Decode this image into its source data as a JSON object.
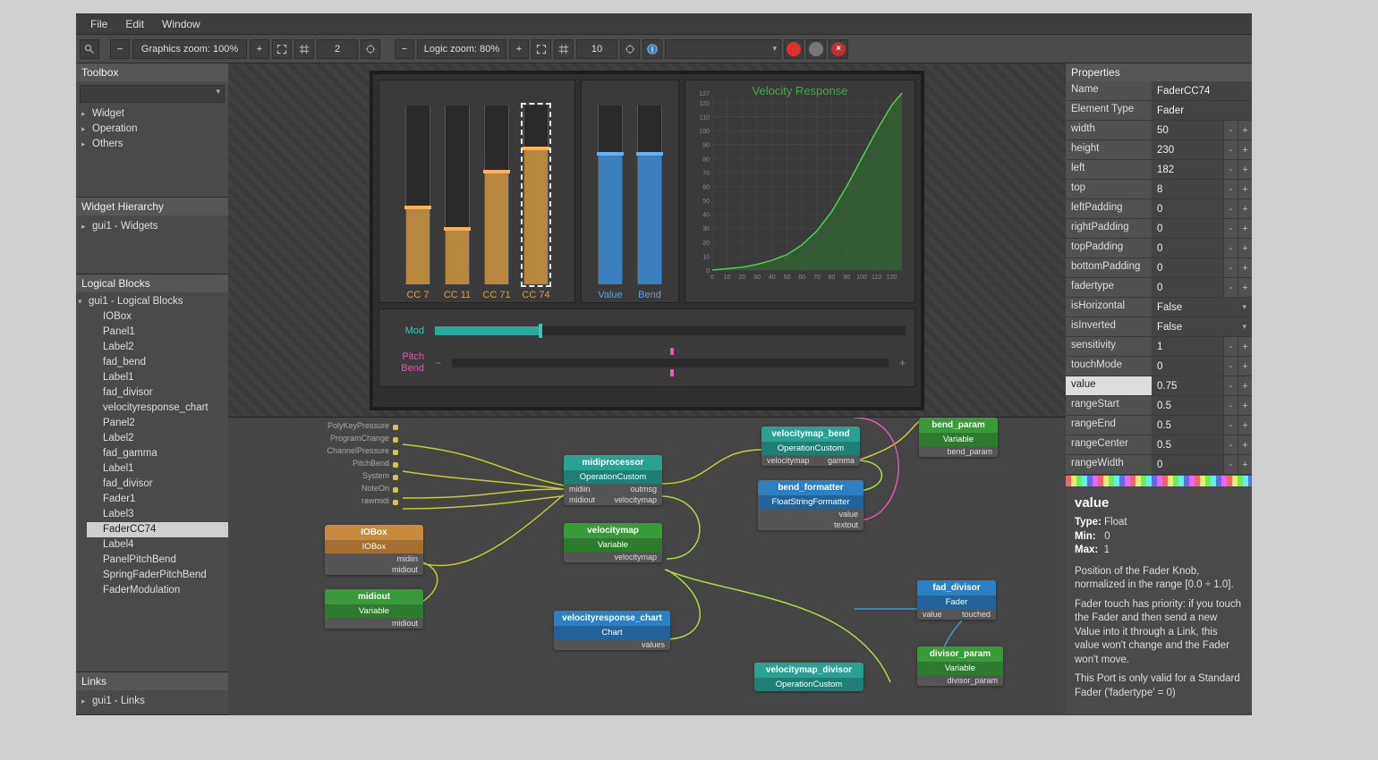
{
  "menu": {
    "file": "File",
    "edit": "Edit",
    "window": "Window"
  },
  "toolbar": {
    "gzoom": "Graphics zoom: 100%",
    "gstep": "2",
    "lzoom": "Logic zoom: 80%",
    "lstep": "10"
  },
  "toolbox": {
    "title": "Toolbox",
    "items": [
      "Widget",
      "Operation",
      "Others"
    ]
  },
  "hierarchy": {
    "title": "Widget Hierarchy",
    "root": "gui1 - Widgets"
  },
  "logical": {
    "title": "Logical Blocks",
    "root": "gui1 - Logical Blocks",
    "items": [
      "IOBox",
      "Panel1",
      "Label2",
      "fad_bend",
      "Label1",
      "fad_divisor",
      "velocityresponse_chart",
      "Panel2",
      "Label2",
      "fad_gamma",
      "Label1",
      "fad_divisor",
      "Fader1",
      "Label3",
      "FaderCC74",
      "Label4",
      "PanelPitchBend",
      "SpringFaderPitchBend",
      "FaderModulation"
    ],
    "selected": "FaderCC74"
  },
  "links": {
    "title": "Links",
    "root": "gui1 - Links"
  },
  "preview": {
    "faders_orange": [
      {
        "label": "CC 7",
        "fill": 0.42
      },
      {
        "label": "CC 11",
        "fill": 0.3
      },
      {
        "label": "CC 71",
        "fill": 0.62
      },
      {
        "label": "CC 74",
        "fill": 0.75,
        "selected": true
      }
    ],
    "faders_blue": [
      {
        "label": "Value",
        "fill": 0.72
      },
      {
        "label": "Bend",
        "fill": 0.72
      }
    ],
    "mod": {
      "label": "Mod",
      "value": 0.22
    },
    "pitch": {
      "label": "Pitch Bend",
      "value": 0.5
    }
  },
  "chart_data": {
    "type": "line",
    "title": "Velocity Response",
    "xlabel": "",
    "ylabel": "",
    "xlim": [
      0,
      127
    ],
    "ylim": [
      0,
      127
    ],
    "x": [
      0,
      10,
      20,
      30,
      40,
      50,
      60,
      70,
      80,
      90,
      100,
      110,
      120,
      127
    ],
    "values": [
      0,
      1,
      2,
      4,
      7,
      11,
      18,
      28,
      42,
      60,
      80,
      100,
      118,
      127
    ],
    "x_ticks": [
      0,
      10,
      20,
      30,
      40,
      50,
      60,
      70,
      80,
      90,
      100,
      110,
      120
    ],
    "y_ticks": [
      0,
      10,
      20,
      30,
      40,
      50,
      60,
      70,
      80,
      90,
      100,
      110,
      120,
      127
    ]
  },
  "nodes": {
    "midi_in_ports": [
      "PolyKeyPressure",
      "ProgramChange",
      "ChannelPressure",
      "PitchBend",
      "System",
      "NoteOn",
      "rawmidi"
    ],
    "iobox": {
      "title": "IOBox",
      "sub": "IOBox",
      "ports": [
        "midiin",
        "midiout"
      ]
    },
    "midiout": {
      "title": "midiout",
      "sub": "Variable",
      "ports": [
        "midiout"
      ]
    },
    "midiproc": {
      "title": "midiprocessor",
      "sub": "OperationCustom",
      "left": [
        "midiin",
        "midiout"
      ],
      "right": [
        "outmsg",
        "velocitymap"
      ]
    },
    "velomap": {
      "title": "velocitymap",
      "sub": "Variable",
      "right": [
        "velocitymap"
      ]
    },
    "vrchart": {
      "title": "velocityresponse_chart",
      "sub": "Chart",
      "right": [
        "values"
      ]
    },
    "vmbend": {
      "title": "velocitymap_bend",
      "sub": "OperationCustom",
      "left": [
        "velocitymap"
      ],
      "right": [
        "gamma"
      ]
    },
    "bendfmt": {
      "title": "bend_formatter",
      "sub": "FloatStringFormatter",
      "right": [
        "value",
        "textout"
      ]
    },
    "vmdiv": {
      "title": "velocitymap_divisor",
      "sub": "OperationCustom"
    },
    "bendparam": {
      "title": "bend_param",
      "sub": "Variable",
      "ports": [
        "bend_param"
      ]
    },
    "faddiv": {
      "title": "fad_divisor",
      "sub": "Fader",
      "left": [
        "value"
      ],
      "right": [
        "touched"
      ]
    },
    "divparam": {
      "title": "divisor_param",
      "sub": "Variable",
      "ports": [
        "divisor_param"
      ]
    }
  },
  "properties": {
    "title": "Properties",
    "rows": [
      {
        "k": "Name",
        "v": "FaderCC74",
        "type": "text"
      },
      {
        "k": "Element Type",
        "v": "Fader",
        "type": "text"
      },
      {
        "k": "width",
        "v": "50",
        "type": "num"
      },
      {
        "k": "height",
        "v": "230",
        "type": "num"
      },
      {
        "k": "left",
        "v": "182",
        "type": "num"
      },
      {
        "k": "top",
        "v": "8",
        "type": "num"
      },
      {
        "k": "leftPadding",
        "v": "0",
        "type": "num"
      },
      {
        "k": "rightPadding",
        "v": "0",
        "type": "num"
      },
      {
        "k": "topPadding",
        "v": "0",
        "type": "num"
      },
      {
        "k": "bottomPadding",
        "v": "0",
        "type": "num"
      },
      {
        "k": "fadertype",
        "v": "0",
        "type": "num"
      },
      {
        "k": "isHorizontal",
        "v": "False",
        "type": "combo"
      },
      {
        "k": "isInverted",
        "v": "False",
        "type": "combo"
      },
      {
        "k": "sensitivity",
        "v": "1",
        "type": "num"
      },
      {
        "k": "touchMode",
        "v": "0",
        "type": "num"
      },
      {
        "k": "value",
        "v": "0.75",
        "type": "num",
        "selected": true
      },
      {
        "k": "rangeStart",
        "v": "0.5",
        "type": "num"
      },
      {
        "k": "rangeEnd",
        "v": "0.5",
        "type": "num"
      },
      {
        "k": "rangeCenter",
        "v": "0.5",
        "type": "num"
      },
      {
        "k": "rangeWidth",
        "v": "0",
        "type": "num"
      }
    ]
  },
  "description": {
    "heading": "value",
    "type_label": "Type:",
    "type": "Float",
    "min_label": "Min:",
    "min": "0",
    "max_label": "Max:",
    "max": "1",
    "body": "Position of the Fader Knob, normalized in the range [0.0 ÷ 1.0].\nFader touch has priority: if you touch the Fader and then send a new Value into it through a Link, this value won't change and the Fader won't move.\nThis Port is only valid for a Standard Fader ('fadertype' = 0)"
  }
}
